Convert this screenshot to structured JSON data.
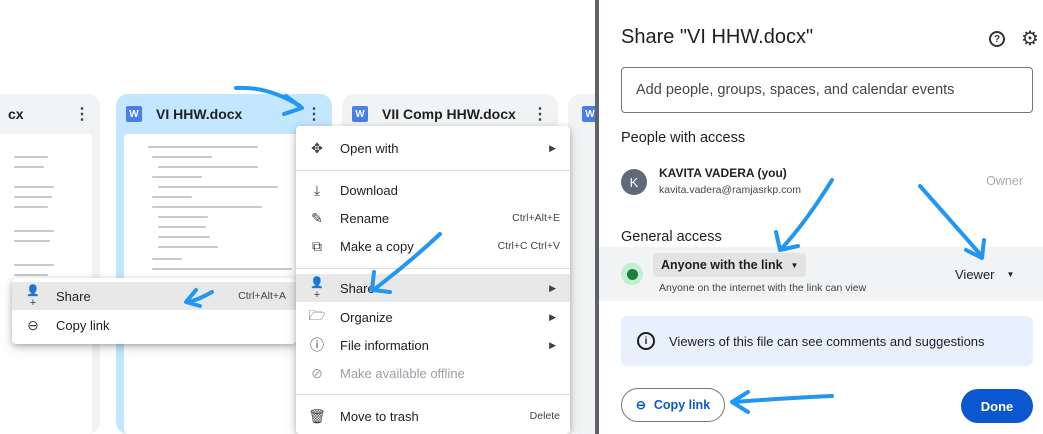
{
  "left": {
    "cards": [
      {
        "name": "cx",
        "partial": true
      },
      {
        "name": "VI HHW.docx"
      },
      {
        "name": "VII Comp HHW.docx"
      }
    ],
    "file_menu": [
      {
        "label": "Open with",
        "icon": "open-with-icon",
        "glyph": "✥",
        "arrow": "▶"
      },
      {
        "label": "Download",
        "icon": "download-icon",
        "glyph": "⤓"
      },
      {
        "label": "Rename",
        "icon": "rename-icon",
        "glyph": "✎",
        "shortcut": "Ctrl+Alt+E"
      },
      {
        "label": "Make a copy",
        "icon": "copy-icon",
        "glyph": "⧉",
        "shortcut": "Ctrl+C Ctrl+V"
      },
      {
        "label": "Share",
        "icon": "share-person-icon",
        "glyph": "👤+",
        "arrow": "▶",
        "highlighted": true
      },
      {
        "label": "Organize",
        "icon": "folder-icon",
        "glyph": "🗁",
        "arrow": "▶"
      },
      {
        "label": "File information",
        "icon": "info-icon",
        "glyph": "ⓘ",
        "arrow": "▶"
      },
      {
        "label": "Make available offline",
        "icon": "offline-icon",
        "glyph": "⊘",
        "disabled": true
      },
      {
        "label": "Move to trash",
        "icon": "trash-icon",
        "glyph": "🗑",
        "shortcut": "Delete"
      }
    ],
    "share_submenu": [
      {
        "label": "Share",
        "icon": "share-person-icon",
        "glyph": "👤+",
        "shortcut": "Ctrl+Alt+A",
        "highlighted": true
      },
      {
        "label": "Copy link",
        "icon": "link-icon",
        "glyph": "⊖"
      }
    ]
  },
  "dialog": {
    "title": "Share \"VI HHW.docx\"",
    "help_icon": "help-icon",
    "settings_icon": "gear-icon",
    "add_placeholder": "Add people, groups, spaces, and calendar events",
    "people_heading": "People with access",
    "person": {
      "initial": "K",
      "name": "KAVITA VADERA (you)",
      "email": "kavita.vadera@ramjasrkp.com",
      "role": "Owner"
    },
    "general_heading": "General access",
    "access": {
      "label": "Anyone with the link",
      "desc": "Anyone on the internet with the link can view",
      "role": "Viewer"
    },
    "info_banner": "Viewers of this file can see comments and suggestions",
    "copy_link": "Copy link",
    "done": "Done"
  },
  "colors": {
    "accent": "#0b57d0",
    "annotation": "#2196f3",
    "banner": "#e8f0fe",
    "highlight_row": "#f1f3f4"
  }
}
